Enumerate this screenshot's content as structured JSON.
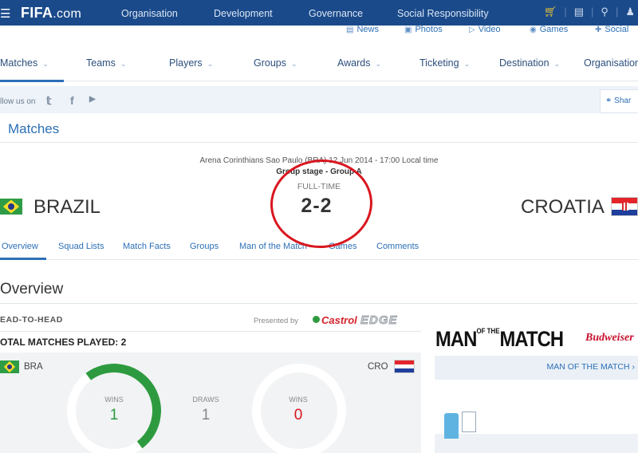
{
  "topbar": {
    "menu_icon": "hamburger-icon",
    "logo_bold": "FIFA",
    "logo_suffix": ".com",
    "nav": [
      "Organisation",
      "Development",
      "Governance",
      "Social Responsibility"
    ],
    "tools": [
      "cart-icon",
      "news-icon",
      "search-icon",
      "user-icon"
    ]
  },
  "subnav": [
    {
      "icon": "news-icon",
      "label": "News"
    },
    {
      "icon": "camera-icon",
      "label": "Photos"
    },
    {
      "icon": "video-icon",
      "label": "Video"
    },
    {
      "icon": "gamepad-icon",
      "label": "Games"
    },
    {
      "icon": "social-icon",
      "label": "Social"
    }
  ],
  "mainnav": [
    "Matches",
    "Teams",
    "Players",
    "Groups",
    "Awards",
    "Ticketing",
    "Destination",
    "Organisation"
  ],
  "follow": {
    "label": "llow us on",
    "share": "Shar"
  },
  "section_title": "Matches",
  "match": {
    "venue": "Arena Corinthians  Sao Paulo (BRA)  12 Jun 2014 - 17:00 Local time",
    "stage": "Group stage - Group A",
    "status": "FULL-TIME",
    "score": "2-2",
    "home": "BRAZIL",
    "away": "CROATIA"
  },
  "tabs": [
    "Overview",
    "Squad Lists",
    "Match Facts",
    "Groups",
    "Man of the Match",
    "Games",
    "Comments"
  ],
  "overview_title": "Overview",
  "h2h": {
    "label": "EAD-TO-HEAD",
    "presented_by": "Presented by",
    "sponsor_a": "Castrol",
    "sponsor_b": "EDGE",
    "total": "OTAL MATCHES PLAYED: 2",
    "home_code": "BRA",
    "away_code": "CRO",
    "wins_label": "WINS",
    "draws_label": "DRAWS",
    "home_wins": "1",
    "draws": "1",
    "away_wins": "0"
  },
  "motm": {
    "title_a": "MAN",
    "title_of": "OF THE",
    "title_b": "MATCH",
    "sponsor": "Budweiser",
    "link": "MAN OF THE MATCH ›"
  },
  "colors": {
    "brand": "#1a4a8a",
    "link": "#2c6fb6",
    "win": "#2e9a3f",
    "loss": "#d9161f",
    "annotation": "#d9161f"
  }
}
